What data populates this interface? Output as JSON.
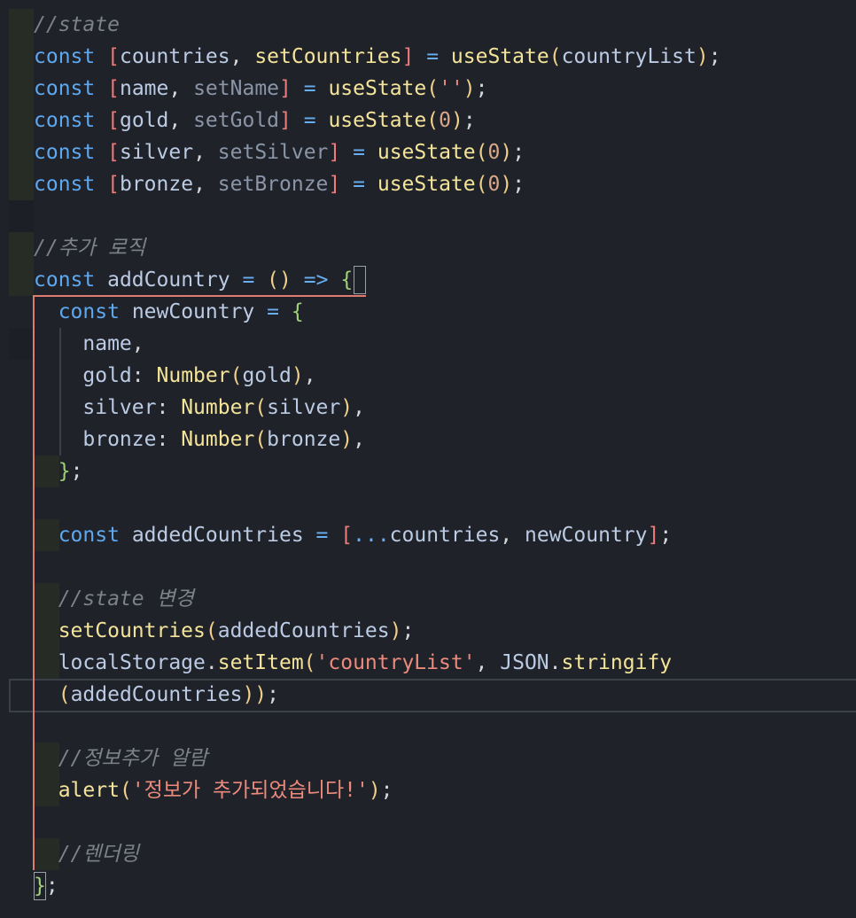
{
  "editor": {
    "language": "javascript",
    "lines": [
      "//state",
      "const [countries, setCountries] = useState(countryList);",
      "const [name, setName] = useState('');",
      "const [gold, setGold] = useState(0);",
      "const [silver, setSilver] = useState(0);",
      "const [bronze, setBronze] = useState(0);",
      "",
      "//추가 로직",
      "const addCountry = () => {",
      "  const newCountry = {",
      "    name,",
      "    gold: Number(gold),",
      "    silver: Number(silver),",
      "    bronze: Number(bronze),",
      "  };",
      "",
      "  const addedCountries = [...countries, newCountry];",
      "",
      "  //state 변경",
      "  setCountries(addedCountries);",
      "  localStorage.setItem('countryList', JSON.stringify",
      "  (addedCountries));",
      "",
      "  //정보추가 알람",
      "  alert('정보가 추가되었습니다!');",
      "",
      "  //렌더링",
      "};"
    ]
  },
  "colors": {
    "background": "#1f2229",
    "keyword": "#5ea8ef",
    "function": "#f4e49a",
    "string": "#ec8a7c",
    "comment": "#7d818a",
    "scope_highlight": "#e07b72"
  }
}
